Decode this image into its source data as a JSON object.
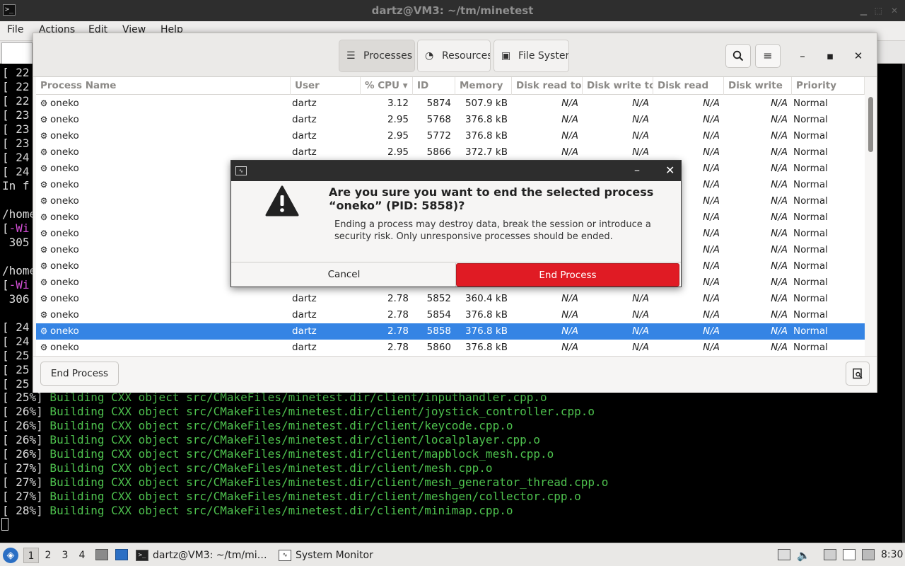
{
  "terminal": {
    "title": "dartz@VM3: ~/tm/minetest",
    "menu": [
      "File",
      "Actions",
      "Edit",
      "View",
      "Help"
    ],
    "left_fragments": [
      "[ 22",
      "[ 22",
      "[ 22",
      "[ 23",
      "[ 23",
      "[ 23",
      "[ 24",
      "[ 24",
      "In f",
      "",
      "/home",
      "[-Wi",
      " 305",
      "",
      "/home",
      "[-Wi",
      " 306",
      "",
      "[ 24",
      "[ 24",
      "[ 25",
      "[ 25",
      "[ 25"
    ],
    "build_lines": [
      {
        "pct": "[ 25%]",
        "text": " Building CXX object src/CMakeFiles/minetest.dir/client/inputhandler.cpp.o"
      },
      {
        "pct": "[ 26%]",
        "text": " Building CXX object src/CMakeFiles/minetest.dir/client/joystick_controller.cpp.o"
      },
      {
        "pct": "[ 26%]",
        "text": " Building CXX object src/CMakeFiles/minetest.dir/client/keycode.cpp.o"
      },
      {
        "pct": "[ 26%]",
        "text": " Building CXX object src/CMakeFiles/minetest.dir/client/localplayer.cpp.o"
      },
      {
        "pct": "[ 26%]",
        "text": " Building CXX object src/CMakeFiles/minetest.dir/client/mapblock_mesh.cpp.o"
      },
      {
        "pct": "[ 27%]",
        "text": " Building CXX object src/CMakeFiles/minetest.dir/client/mesh.cpp.o"
      },
      {
        "pct": "[ 27%]",
        "text": " Building CXX object src/CMakeFiles/minetest.dir/client/mesh_generator_thread.cpp.o"
      },
      {
        "pct": "[ 27%]",
        "text": " Building CXX object src/CMakeFiles/minetest.dir/client/meshgen/collector.cpp.o"
      },
      {
        "pct": "[ 28%]",
        "text": " Building CXX object src/CMakeFiles/minetest.dir/client/minimap.cpp.o"
      }
    ]
  },
  "sysmon": {
    "tabs": [
      {
        "label": "Processes",
        "icon": "list-icon"
      },
      {
        "label": "Resources",
        "icon": "gauge-icon"
      },
      {
        "label": "File Syster",
        "icon": "disk-icon"
      }
    ],
    "columns": [
      "Process Name",
      "User",
      "% CPU",
      "ID",
      "Memory",
      "Disk read to",
      "Disk write to",
      "Disk read",
      "Disk write",
      "Priority"
    ],
    "rows": [
      {
        "name": "oneko",
        "user": "dartz",
        "cpu": "3.12",
        "id": "5874",
        "mem": "507.9 kB",
        "dr": "N/A",
        "dw": "N/A",
        "drr": "N/A",
        "dwr": "N/A",
        "prio": "Normal"
      },
      {
        "name": "oneko",
        "user": "dartz",
        "cpu": "2.95",
        "id": "5768",
        "mem": "376.8 kB",
        "dr": "N/A",
        "dw": "N/A",
        "drr": "N/A",
        "dwr": "N/A",
        "prio": "Normal"
      },
      {
        "name": "oneko",
        "user": "dartz",
        "cpu": "2.95",
        "id": "5772",
        "mem": "376.8 kB",
        "dr": "N/A",
        "dw": "N/A",
        "drr": "N/A",
        "dwr": "N/A",
        "prio": "Normal"
      },
      {
        "name": "oneko",
        "user": "dartz",
        "cpu": "2.95",
        "id": "5866",
        "mem": "372.7 kB",
        "dr": "N/A",
        "dw": "N/A",
        "drr": "N/A",
        "dwr": "N/A",
        "prio": "Normal"
      },
      {
        "name": "oneko",
        "user": "",
        "cpu": "",
        "id": "",
        "mem": "",
        "dr": "",
        "dw": "",
        "drr": "N/A",
        "dwr": "N/A",
        "prio": "Normal"
      },
      {
        "name": "oneko",
        "user": "",
        "cpu": "",
        "id": "",
        "mem": "",
        "dr": "",
        "dw": "",
        "drr": "N/A",
        "dwr": "N/A",
        "prio": "Normal"
      },
      {
        "name": "oneko",
        "user": "",
        "cpu": "",
        "id": "",
        "mem": "",
        "dr": "",
        "dw": "",
        "drr": "N/A",
        "dwr": "N/A",
        "prio": "Normal"
      },
      {
        "name": "oneko",
        "user": "",
        "cpu": "",
        "id": "",
        "mem": "",
        "dr": "",
        "dw": "",
        "drr": "N/A",
        "dwr": "N/A",
        "prio": "Normal"
      },
      {
        "name": "oneko",
        "user": "",
        "cpu": "",
        "id": "",
        "mem": "",
        "dr": "",
        "dw": "",
        "drr": "N/A",
        "dwr": "N/A",
        "prio": "Normal"
      },
      {
        "name": "oneko",
        "user": "",
        "cpu": "",
        "id": "",
        "mem": "",
        "dr": "",
        "dw": "",
        "drr": "N/A",
        "dwr": "N/A",
        "prio": "Normal"
      },
      {
        "name": "oneko",
        "user": "",
        "cpu": "",
        "id": "",
        "mem": "",
        "dr": "",
        "dw": "",
        "drr": "N/A",
        "dwr": "N/A",
        "prio": "Normal"
      },
      {
        "name": "oneko",
        "user": "",
        "cpu": "",
        "id": "",
        "mem": "",
        "dr": "",
        "dw": "",
        "drr": "N/A",
        "dwr": "N/A",
        "prio": "Normal"
      },
      {
        "name": "oneko",
        "user": "dartz",
        "cpu": "2.78",
        "id": "5852",
        "mem": "360.4 kB",
        "dr": "N/A",
        "dw": "N/A",
        "drr": "N/A",
        "dwr": "N/A",
        "prio": "Normal"
      },
      {
        "name": "oneko",
        "user": "dartz",
        "cpu": "2.78",
        "id": "5854",
        "mem": "376.8 kB",
        "dr": "N/A",
        "dw": "N/A",
        "drr": "N/A",
        "dwr": "N/A",
        "prio": "Normal"
      },
      {
        "name": "oneko",
        "user": "dartz",
        "cpu": "2.78",
        "id": "5858",
        "mem": "376.8 kB",
        "dr": "N/A",
        "dw": "N/A",
        "drr": "N/A",
        "dwr": "N/A",
        "prio": "Normal",
        "selected": true
      },
      {
        "name": "oneko",
        "user": "dartz",
        "cpu": "2.78",
        "id": "5860",
        "mem": "376.8 kB",
        "dr": "N/A",
        "dw": "N/A",
        "drr": "N/A",
        "dwr": "N/A",
        "prio": "Normal"
      }
    ],
    "footer": {
      "end_process_label": "End Process"
    }
  },
  "dialog": {
    "heading_line1": "Are you sure you want to end the selected process",
    "heading_line2": "“oneko” (PID: 5858)?",
    "body": "Ending a process may destroy data, break the session or introduce a security risk. Only unresponsive processes should be ended.",
    "cancel_label": "Cancel",
    "end_label": "End Process",
    "end_color": "#e01b24"
  },
  "taskbar": {
    "workspaces": [
      "1",
      "2",
      "3",
      "4"
    ],
    "active_workspace": "1",
    "tasks": [
      {
        "label": "dartz@VM3: ~/tm/mi…",
        "icon": "terminal-icon"
      },
      {
        "label": "System Monitor",
        "icon": "system-monitor-icon"
      }
    ],
    "clock": "8:30"
  },
  "colors": {
    "selection": "#3584e4",
    "terminal_green": "#4ec24e",
    "terminal_magenta": "#d44fd6"
  }
}
